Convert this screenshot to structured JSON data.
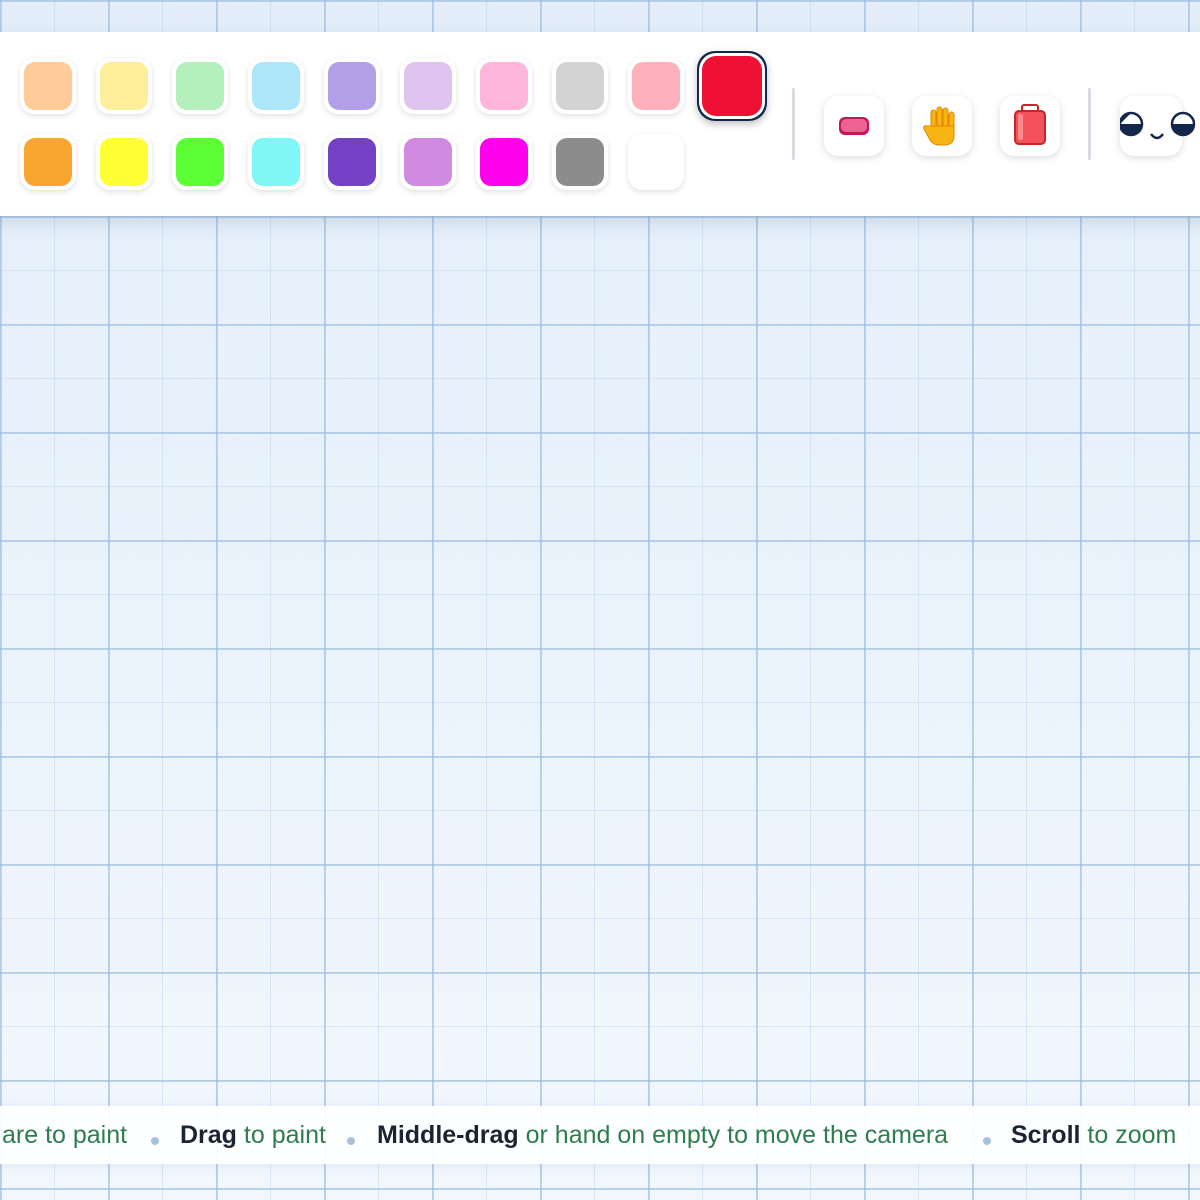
{
  "palette": {
    "selected_color": "#ee1134",
    "row1": [
      {
        "name": "peach",
        "color": "#ffcc99"
      },
      {
        "name": "light-yellow",
        "color": "#ffee99"
      },
      {
        "name": "light-green",
        "color": "#b3f0bc"
      },
      {
        "name": "light-cyan",
        "color": "#aee6f9"
      },
      {
        "name": "lavender",
        "color": "#b39fe6"
      },
      {
        "name": "light-lilac",
        "color": "#e0c4f0"
      },
      {
        "name": "light-pink",
        "color": "#ffb5dc"
      },
      {
        "name": "light-gray",
        "color": "#d3d3d3"
      },
      {
        "name": "rose",
        "color": "#ffb0bc"
      },
      {
        "name": "red",
        "color": "#ee1134"
      }
    ],
    "row2": [
      {
        "name": "orange",
        "color": "#f9a630"
      },
      {
        "name": "yellow",
        "color": "#ffff33"
      },
      {
        "name": "green",
        "color": "#5cff33"
      },
      {
        "name": "cyan",
        "color": "#7ff7f7"
      },
      {
        "name": "purple",
        "color": "#7440c4"
      },
      {
        "name": "orchid",
        "color": "#d08ae0"
      },
      {
        "name": "magenta",
        "color": "#ff00ee"
      },
      {
        "name": "gray",
        "color": "#8c8c8c"
      },
      {
        "name": "white",
        "color": "#ffffff"
      }
    ]
  },
  "tools": [
    {
      "name": "eraser-icon"
    },
    {
      "name": "hand-icon"
    },
    {
      "name": "clear-bucket-icon"
    },
    {
      "name": "face-icon"
    }
  ],
  "hints": [
    {
      "bold": "",
      "text": "are to paint"
    },
    {
      "bold": "Drag",
      "text": " to paint"
    },
    {
      "bold": "Middle-drag",
      "text": " or hand on empty to move the camera"
    },
    {
      "bold": "Scroll",
      "text": " to zoom"
    }
  ]
}
